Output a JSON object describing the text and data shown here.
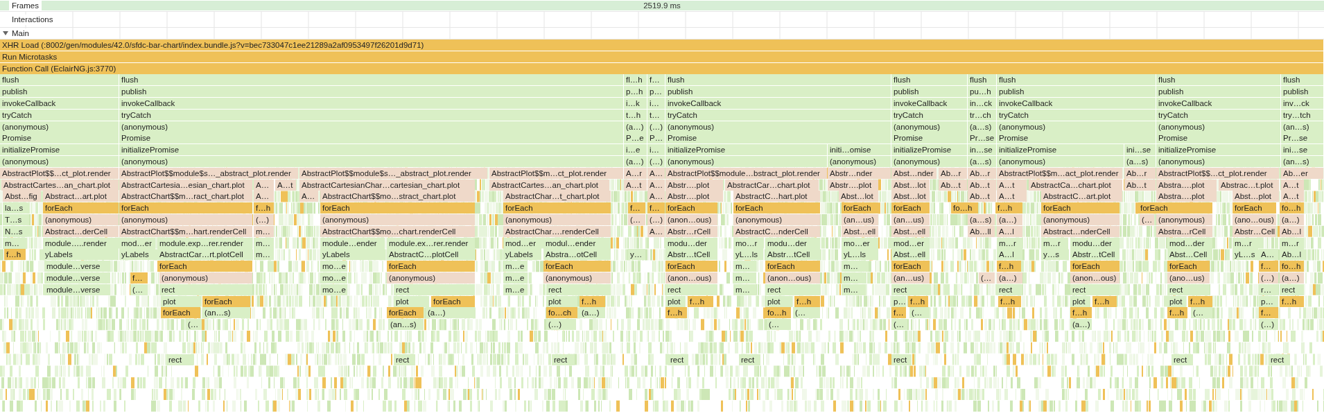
{
  "tracks": [
    {
      "label": "Frames",
      "duration": "2519.9 ms"
    },
    {
      "label": "Interactions"
    },
    {
      "label": "Main",
      "expanded": true
    }
  ],
  "flame_rows": [
    {
      "blocks": [
        {
          "label": "XHR Load (:8002/gen/modules/42.0/sfdc-bar-chart/index.bundle.js?v=bec733047c1ee21289a2af0953497f26201d9d71)",
          "color": "#efc158"
        }
      ]
    },
    {
      "blocks": [
        {
          "label": "Run Microtasks",
          "color": "#efc158"
        }
      ]
    },
    {
      "blocks": [
        {
          "label": "Function Call (EclairNG.js:3770)",
          "color": "#efc158"
        }
      ]
    },
    {
      "blocks": [
        {
          "label": "flush",
          "color": "#d9efc6"
        },
        {
          "label": "flush",
          "color": "#d9efc6"
        },
        {
          "label": "fl…h",
          "color": "#d9efc6"
        },
        {
          "label": "f…",
          "color": "#d9efc6"
        },
        {
          "label": "flush",
          "color": "#d9efc6"
        },
        {
          "label": "flush",
          "color": "#d9efc6"
        },
        {
          "label": "flush",
          "color": "#d9efc6"
        },
        {
          "label": "flush",
          "color": "#d9efc6"
        },
        {
          "label": "flush",
          "color": "#d9efc6"
        },
        {
          "label": "flush",
          "color": "#d9efc6"
        }
      ]
    },
    {
      "blocks": [
        {
          "label": "publish",
          "color": "#d9efc6"
        },
        {
          "label": "publish",
          "color": "#d9efc6"
        },
        {
          "label": "p…h",
          "color": "#d9efc6"
        },
        {
          "label": "p…",
          "color": "#d9efc6"
        },
        {
          "label": "publish",
          "color": "#d9efc6"
        },
        {
          "label": "publish",
          "color": "#d9efc6"
        },
        {
          "label": "pu…h",
          "color": "#d9efc6"
        },
        {
          "label": "publish",
          "color": "#d9efc6"
        },
        {
          "label": "publish",
          "color": "#d9efc6"
        },
        {
          "label": "publish",
          "color": "#d9efc6"
        }
      ]
    },
    {
      "blocks": [
        {
          "label": "invokeCallback",
          "color": "#d9efc6"
        },
        {
          "label": "invokeCallback",
          "color": "#d9efc6"
        },
        {
          "label": "i…k",
          "color": "#d9efc6"
        },
        {
          "label": "i…",
          "color": "#d9efc6"
        },
        {
          "label": "invokeCallback",
          "color": "#d9efc6"
        },
        {
          "label": "invokeCallback",
          "color": "#d9efc6"
        },
        {
          "label": "in…ck",
          "color": "#d9efc6"
        },
        {
          "label": "invokeCallback",
          "color": "#d9efc6"
        },
        {
          "label": "invokeCallback",
          "color": "#d9efc6"
        },
        {
          "label": "inv…ck",
          "color": "#d9efc6"
        }
      ]
    },
    {
      "blocks": [
        {
          "label": "tryCatch",
          "color": "#d9efc6"
        },
        {
          "label": "tryCatch",
          "color": "#d9efc6"
        },
        {
          "label": "t…h",
          "color": "#d9efc6"
        },
        {
          "label": "t…",
          "color": "#d9efc6"
        },
        {
          "label": "tryCatch",
          "color": "#d9efc6"
        },
        {
          "label": "tryCatch",
          "color": "#d9efc6"
        },
        {
          "label": "tr…ch",
          "color": "#d9efc6"
        },
        {
          "label": "tryCatch",
          "color": "#d9efc6"
        },
        {
          "label": "tryCatch",
          "color": "#d9efc6"
        },
        {
          "label": "try…tch",
          "color": "#d9efc6"
        }
      ]
    },
    {
      "blocks": [
        {
          "label": "(anonymous)",
          "color": "#d9efc6"
        },
        {
          "label": "(anonymous)",
          "color": "#d9efc6"
        },
        {
          "label": "(a…)",
          "color": "#d9efc6"
        },
        {
          "label": "(…)",
          "color": "#d9efc6"
        },
        {
          "label": "(anonymous)",
          "color": "#d9efc6"
        },
        {
          "label": "(anonymous)",
          "color": "#d9efc6"
        },
        {
          "label": "(a…s)",
          "color": "#d9efc6"
        },
        {
          "label": "(anonymous)",
          "color": "#d9efc6"
        },
        {
          "label": "(anonymous)",
          "color": "#d9efc6"
        },
        {
          "label": "(an…s)",
          "color": "#d9efc6"
        }
      ]
    },
    {
      "blocks": [
        {
          "label": "Promise",
          "color": "#d9efc6"
        },
        {
          "label": "Promise",
          "color": "#d9efc6"
        },
        {
          "label": "P…e",
          "color": "#d9efc6"
        },
        {
          "label": "P…",
          "color": "#d9efc6"
        },
        {
          "label": "Promise",
          "color": "#d9efc6"
        },
        {
          "label": "Promise",
          "color": "#d9efc6"
        },
        {
          "label": "Pr…se",
          "color": "#d9efc6"
        },
        {
          "label": "Promise",
          "color": "#d9efc6"
        },
        {
          "label": "Promise",
          "color": "#d9efc6"
        },
        {
          "label": "Pr…se",
          "color": "#d9efc6"
        }
      ]
    },
    {
      "blocks": [
        {
          "label": "initializePromise",
          "color": "#d9efc6"
        },
        {
          "label": "initializePromise",
          "color": "#d9efc6"
        },
        {
          "label": "i…e",
          "color": "#d9efc6"
        },
        {
          "label": "i…",
          "color": "#d9efc6"
        },
        {
          "label": "initializePromise",
          "color": "#d9efc6"
        },
        {
          "label": "initi…omise",
          "color": "#d9efc6"
        },
        {
          "label": "initializePromise",
          "color": "#d9efc6"
        },
        {
          "label": "in…se",
          "color": "#d9efc6"
        },
        {
          "label": "initializePromise",
          "color": "#d9efc6"
        },
        {
          "label": "ini…se",
          "color": "#d9efc6"
        },
        {
          "label": "initializePromise",
          "color": "#d9efc6"
        },
        {
          "label": "ini…se",
          "color": "#d9efc6"
        }
      ]
    },
    {
      "blocks": [
        {
          "label": "(anonymous)",
          "color": "#d9efc6"
        },
        {
          "label": "(anonymous)",
          "color": "#d9efc6"
        },
        {
          "label": "(a…)",
          "color": "#d9efc6"
        },
        {
          "label": "(…)",
          "color": "#d9efc6"
        },
        {
          "label": "(anonymous)",
          "color": "#d9efc6"
        },
        {
          "label": "(anonymous)",
          "color": "#d9efc6"
        },
        {
          "label": "(anonymous)",
          "color": "#d9efc6"
        },
        {
          "label": "(a…s)",
          "color": "#d9efc6"
        },
        {
          "label": "(anonymous)",
          "color": "#d9efc6"
        },
        {
          "label": "(a…s)",
          "color": "#d9efc6"
        },
        {
          "label": "(anonymous)",
          "color": "#d9efc6"
        },
        {
          "label": "(an…s)",
          "color": "#d9efc6"
        }
      ]
    },
    {
      "blocks": [
        {
          "label": "AbstractPlot$$…ct_plot.render",
          "color": "#efd9c9"
        },
        {
          "label": "AbstractPlot$$module$s…_abstract_plot.render",
          "color": "#efd9c9"
        },
        {
          "label": "AbstractPlot$$module$s…_abstract_plot.render",
          "color": "#efd9c9"
        },
        {
          "label": "AbstractPlot$$m…ct_plot.render",
          "color": "#efd9c9"
        },
        {
          "label": "A…r",
          "color": "#efd9c9"
        },
        {
          "label": "A…",
          "color": "#efd9c9"
        },
        {
          "label": "AbstractPlot$$module…bstract_plot.render",
          "color": "#efd9c9"
        },
        {
          "label": "Abstr…nder",
          "color": "#efd9c9"
        },
        {
          "label": "Abst…nder",
          "color": "#efd9c9"
        },
        {
          "label": "Ab…r",
          "color": "#efd9c9"
        },
        {
          "label": "Ab…r",
          "color": "#efd9c9"
        },
        {
          "label": "AbstractPlot$$m…act_plot.render",
          "color": "#efd9c9"
        },
        {
          "label": "Ab…r",
          "color": "#efd9c9"
        },
        {
          "label": "AbstractPlot$$…ct_plot.render",
          "color": "#efd9c9"
        },
        {
          "label": "Ab…er",
          "color": "#efd9c9"
        }
      ]
    },
    {
      "blocks": [
        {
          "label": "AbstractCartes…an_chart.plot",
          "color": "#efd9c9"
        },
        {
          "label": "AbstractCartesia…esian_chart.plot",
          "color": "#efd9c9"
        },
        {
          "label": "A…",
          "color": "#efd9c9"
        },
        {
          "label": "A…t",
          "color": "#efd9c9"
        },
        {
          "label": "AbstractCartesianChar…cartesian_chart.plot",
          "color": "#efd9c9"
        },
        {
          "label": "AbstractCartes…an_chart.plot",
          "color": "#efd9c9"
        },
        {
          "label": "A…t",
          "color": "#efd9c9"
        },
        {
          "label": "A…",
          "color": "#efd9c9"
        },
        {
          "label": "Abstr….plot",
          "color": "#efd9c9"
        },
        {
          "label": "AbstractCar…chart.plot",
          "color": "#efd9c9"
        },
        {
          "label": "Abstr….plot",
          "color": "#efd9c9"
        },
        {
          "label": "Abst…lot",
          "color": "#efd9c9"
        },
        {
          "label": "Ab…t",
          "color": "#efd9c9"
        },
        {
          "label": "Ab…t",
          "color": "#efd9c9"
        },
        {
          "label": "A…t",
          "color": "#efd9c9"
        },
        {
          "label": "AbstractCa…chart.plot",
          "color": "#efd9c9"
        },
        {
          "label": "Ab…t",
          "color": "#efd9c9"
        },
        {
          "label": "Abstra….plot",
          "color": "#efd9c9"
        },
        {
          "label": "Abstrac…t.plot",
          "color": "#efd9c9"
        },
        {
          "label": "A…t",
          "color": "#efd9c9"
        }
      ]
    },
    {
      "blocks": [
        {
          "label": "Abst…fig",
          "color": "#efd9c9"
        },
        {
          "label": "Abstract…art.plot",
          "color": "#efd9c9"
        },
        {
          "label": "AbstractChart$$m…ract_chart.plot",
          "color": "#efd9c9"
        },
        {
          "label": "A…",
          "color": "#efd9c9"
        },
        {
          "label": "A…",
          "color": "#efd9c9"
        },
        {
          "label": "AbstractChart$$mo…stract_chart.plot",
          "color": "#efd9c9"
        },
        {
          "label": "AbstractChar…t_chart.plot",
          "color": "#efd9c9"
        },
        {
          "label": "A…",
          "color": "#efd9c9"
        },
        {
          "label": "Abstr….plot",
          "color": "#efd9c9"
        },
        {
          "label": "AbstractC…hart.plot",
          "color": "#efd9c9"
        },
        {
          "label": "Abst…lot",
          "color": "#efd9c9"
        },
        {
          "label": "Abst…lot",
          "color": "#efd9c9"
        },
        {
          "label": "Ab…t",
          "color": "#efd9c9"
        },
        {
          "label": "A…t",
          "color": "#efd9c9"
        },
        {
          "label": "AbstractC…art.plot",
          "color": "#efd9c9"
        },
        {
          "label": "Abstra….plot",
          "color": "#efd9c9"
        },
        {
          "label": "Abst…plot",
          "color": "#efd9c9"
        },
        {
          "label": "A…t",
          "color": "#efd9c9"
        }
      ]
    },
    {
      "blocks": [
        {
          "label": "la…s",
          "color": "#d9efc6"
        },
        {
          "label": "forEach",
          "color": "#efc158"
        },
        {
          "label": "forEach",
          "color": "#efc158"
        },
        {
          "label": "f…h",
          "color": "#efc158"
        },
        {
          "label": "forEach",
          "color": "#efc158"
        },
        {
          "label": "forEach",
          "color": "#efc158"
        },
        {
          "label": "f…",
          "color": "#efc158"
        },
        {
          "label": "f…",
          "color": "#efc158"
        },
        {
          "label": "forEach",
          "color": "#efc158"
        },
        {
          "label": "forEach",
          "color": "#efc158"
        },
        {
          "label": "forEach",
          "color": "#efc158"
        },
        {
          "label": "forEach",
          "color": "#efc158"
        },
        {
          "label": "fo…h",
          "color": "#efc158"
        },
        {
          "label": "f…h",
          "color": "#efc158"
        },
        {
          "label": "forEach",
          "color": "#efc158"
        },
        {
          "label": "forEach",
          "color": "#efc158"
        },
        {
          "label": "forEach",
          "color": "#efc158"
        },
        {
          "label": "fo…h",
          "color": "#efc158"
        }
      ]
    },
    {
      "blocks": [
        {
          "label": "T…s",
          "color": "#d9efc6"
        },
        {
          "label": "(anonymous)",
          "color": "#efd9c9"
        },
        {
          "label": "(anonymous)",
          "color": "#efd9c9"
        },
        {
          "label": "(…)",
          "color": "#efd9c9"
        },
        {
          "label": "(anonymous)",
          "color": "#efd9c9"
        },
        {
          "label": "(anonymous)",
          "color": "#efd9c9"
        },
        {
          "label": "(…",
          "color": "#efd9c9"
        },
        {
          "label": "(…)",
          "color": "#efd9c9"
        },
        {
          "label": "(anon…ous)",
          "color": "#efd9c9"
        },
        {
          "label": "(anonymous)",
          "color": "#efd9c9"
        },
        {
          "label": "(an…us)",
          "color": "#efd9c9"
        },
        {
          "label": "(an…us)",
          "color": "#efd9c9"
        },
        {
          "label": "(a…s)",
          "color": "#efd9c9"
        },
        {
          "label": "(a…)",
          "color": "#efd9c9"
        },
        {
          "label": "(anonymous)",
          "color": "#efd9c9"
        },
        {
          "label": "(…",
          "color": "#efd9c9"
        },
        {
          "label": "(anonymous)",
          "color": "#efd9c9"
        },
        {
          "label": "(ano…ous)",
          "color": "#efd9c9"
        },
        {
          "label": "(a…)",
          "color": "#efd9c9"
        }
      ]
    },
    {
      "blocks": [
        {
          "label": "N…s",
          "color": "#d9efc6"
        },
        {
          "label": "Abstract…derCell",
          "color": "#efd9c9"
        },
        {
          "label": "AbstractChart$$m…hart.renderCell",
          "color": "#efd9c9"
        },
        {
          "label": "m…",
          "color": "#efd9c9"
        },
        {
          "label": "AbstractChart$$mo…chart.renderCell",
          "color": "#efd9c9"
        },
        {
          "label": "AbstractChar….renderCell",
          "color": "#efd9c9"
        },
        {
          "label": "A…",
          "color": "#efd9c9"
        },
        {
          "label": "Abstr…rCell",
          "color": "#efd9c9"
        },
        {
          "label": "AbstractC…nderCell",
          "color": "#efd9c9"
        },
        {
          "label": "Abst…ell",
          "color": "#efd9c9"
        },
        {
          "label": "Abst…ell",
          "color": "#efd9c9"
        },
        {
          "label": "Ab…ll",
          "color": "#efd9c9"
        },
        {
          "label": "A…l",
          "color": "#efd9c9"
        },
        {
          "label": "Abstract…nderCell",
          "color": "#efd9c9"
        },
        {
          "label": "Abstra…rCell",
          "color": "#efd9c9"
        },
        {
          "label": "Abstr…Cell",
          "color": "#efd9c9"
        },
        {
          "label": "Ab…l",
          "color": "#efd9c9"
        }
      ]
    },
    {
      "blocks": [
        {
          "label": "m…",
          "color": "#d9efc6"
        },
        {
          "label": "module…..render",
          "color": "#d9efc6"
        },
        {
          "label": "mod…er",
          "color": "#d9efc6"
        },
        {
          "label": "module.exp…rer.render",
          "color": "#d9efc6"
        },
        {
          "label": "m…",
          "color": "#d9efc6"
        },
        {
          "label": "module…ender",
          "color": "#d9efc6"
        },
        {
          "label": "module.ex…rer.render",
          "color": "#d9efc6"
        },
        {
          "label": "mod…er",
          "color": "#d9efc6"
        },
        {
          "label": "modul…ender",
          "color": "#d9efc6"
        },
        {
          "label": "modu…der",
          "color": "#d9efc6"
        },
        {
          "label": "mo…r",
          "color": "#d9efc6"
        },
        {
          "label": "modu…der",
          "color": "#d9efc6"
        },
        {
          "label": "mo…er",
          "color": "#d9efc6"
        },
        {
          "label": "mod…er",
          "color": "#d9efc6"
        },
        {
          "label": "m…r",
          "color": "#d9efc6"
        },
        {
          "label": "m…r",
          "color": "#d9efc6"
        },
        {
          "label": "modu…der",
          "color": "#d9efc6"
        },
        {
          "label": "mod…der",
          "color": "#d9efc6"
        },
        {
          "label": "m…r",
          "color": "#d9efc6"
        },
        {
          "label": "m…r",
          "color": "#d9efc6"
        }
      ]
    },
    {
      "blocks": [
        {
          "label": "f…h",
          "color": "#efc158"
        },
        {
          "label": "yLabels",
          "color": "#d9efc6"
        },
        {
          "label": "yLabels",
          "color": "#d9efc6"
        },
        {
          "label": "AbstractCar…rt.plotCell",
          "color": "#d9efc6"
        },
        {
          "label": "m…",
          "color": "#d9efc6"
        },
        {
          "label": "yLabels",
          "color": "#d9efc6"
        },
        {
          "label": "AbstractC…plotCell",
          "color": "#d9efc6"
        },
        {
          "label": "yLabels",
          "color": "#d9efc6"
        },
        {
          "label": "Abstra…otCell",
          "color": "#d9efc6"
        },
        {
          "label": "y…",
          "color": "#d9efc6"
        },
        {
          "label": "Abstr…tCell",
          "color": "#d9efc6"
        },
        {
          "label": "yL…ls",
          "color": "#d9efc6"
        },
        {
          "label": "Abstr…tCell",
          "color": "#d9efc6"
        },
        {
          "label": "yL…ls",
          "color": "#d9efc6"
        },
        {
          "label": "Abst…ell",
          "color": "#d9efc6"
        },
        {
          "label": "A…l",
          "color": "#d9efc6"
        },
        {
          "label": "y…s",
          "color": "#d9efc6"
        },
        {
          "label": "Abstr…tCell",
          "color": "#d9efc6"
        },
        {
          "label": "Abst…Cell",
          "color": "#d9efc6"
        },
        {
          "label": "yL…s",
          "color": "#d9efc6"
        },
        {
          "label": "A…",
          "color": "#d9efc6"
        },
        {
          "label": "Ab…l",
          "color": "#d9efc6"
        }
      ]
    },
    {
      "blocks": [
        {
          "label": "module…verse",
          "color": "#d9efc6"
        },
        {
          "label": "forEach",
          "color": "#efc158"
        },
        {
          "label": "mo…e",
          "color": "#d9efc6"
        },
        {
          "label": "forEach",
          "color": "#efc158"
        },
        {
          "label": "m…e",
          "color": "#d9efc6"
        },
        {
          "label": "forEach",
          "color": "#efc158"
        },
        {
          "label": "forEach",
          "color": "#efc158"
        },
        {
          "label": "m…",
          "color": "#d9efc6"
        },
        {
          "label": "forEach",
          "color": "#efc158"
        },
        {
          "label": "m…",
          "color": "#d9efc6"
        },
        {
          "label": "forEach",
          "color": "#efc158"
        },
        {
          "label": "f…h",
          "color": "#efc158"
        },
        {
          "label": "forEach",
          "color": "#efc158"
        },
        {
          "label": "forEach",
          "color": "#efc158"
        },
        {
          "label": "f…",
          "color": "#efc158"
        },
        {
          "label": "fo…h",
          "color": "#efc158"
        }
      ]
    },
    {
      "blocks": [
        {
          "label": "module…verse",
          "color": "#d9efc6"
        },
        {
          "label": "f…",
          "color": "#efc158"
        },
        {
          "label": "(anonymous)",
          "color": "#efd9c9"
        },
        {
          "label": "mo…e",
          "color": "#d9efc6"
        },
        {
          "label": "(anonymous)",
          "color": "#efd9c9"
        },
        {
          "label": "m…e",
          "color": "#d9efc6"
        },
        {
          "label": "(anonymous)",
          "color": "#efd9c9"
        },
        {
          "label": "(anon…ous)",
          "color": "#efd9c9"
        },
        {
          "label": "m…",
          "color": "#d9efc6"
        },
        {
          "label": "(anon…ous)",
          "color": "#efd9c9"
        },
        {
          "label": "m…",
          "color": "#d9efc6"
        },
        {
          "label": "(an…us)",
          "color": "#efd9c9"
        },
        {
          "label": "(…",
          "color": "#efd9c9"
        },
        {
          "label": "(a…)",
          "color": "#efd9c9"
        },
        {
          "label": "(anon…ous)",
          "color": "#efd9c9"
        },
        {
          "label": "(ano…us)",
          "color": "#efd9c9"
        },
        {
          "label": "(…)",
          "color": "#efd9c9"
        },
        {
          "label": "(a…)",
          "color": "#efd9c9"
        }
      ]
    },
    {
      "blocks": [
        {
          "label": "module…verse",
          "color": "#d9efc6"
        },
        {
          "label": "(…",
          "color": "#d9efc6"
        },
        {
          "label": "rect",
          "color": "#d9efc6"
        },
        {
          "label": "mo…e",
          "color": "#d9efc6"
        },
        {
          "label": "rect",
          "color": "#d9efc6"
        },
        {
          "label": "m…e",
          "color": "#d9efc6"
        },
        {
          "label": "rect",
          "color": "#d9efc6"
        },
        {
          "label": "rect",
          "color": "#d9efc6"
        },
        {
          "label": "m…",
          "color": "#d9efc6"
        },
        {
          "label": "rect",
          "color": "#d9efc6"
        },
        {
          "label": "m…",
          "color": "#d9efc6"
        },
        {
          "label": "rect",
          "color": "#d9efc6"
        },
        {
          "label": "rect",
          "color": "#d9efc6"
        },
        {
          "label": "rect",
          "color": "#d9efc6"
        },
        {
          "label": "rect",
          "color": "#d9efc6"
        },
        {
          "label": "r…",
          "color": "#d9efc6"
        },
        {
          "label": "rect",
          "color": "#d9efc6"
        }
      ]
    },
    {
      "blocks": [
        {
          "label": "plot",
          "color": "#d9efc6"
        },
        {
          "label": "forEach",
          "color": "#efc158"
        },
        {
          "label": "plot",
          "color": "#d9efc6"
        },
        {
          "label": "forEach",
          "color": "#efc158"
        },
        {
          "label": "plot",
          "color": "#d9efc6"
        },
        {
          "label": "f…h",
          "color": "#efc158"
        },
        {
          "label": "plot",
          "color": "#d9efc6"
        },
        {
          "label": "f…h",
          "color": "#efc158"
        },
        {
          "label": "plot",
          "color": "#d9efc6"
        },
        {
          "label": "f…h",
          "color": "#efc158"
        },
        {
          "label": "p…",
          "color": "#d9efc6"
        },
        {
          "label": "f…h",
          "color": "#efc158"
        },
        {
          "label": "f…h",
          "color": "#efc158"
        },
        {
          "label": "plot",
          "color": "#d9efc6"
        },
        {
          "label": "f…h",
          "color": "#efc158"
        },
        {
          "label": "plot",
          "color": "#d9efc6"
        },
        {
          "label": "f…h",
          "color": "#efc158"
        },
        {
          "label": "p…",
          "color": "#d9efc6"
        },
        {
          "label": "f…h",
          "color": "#efc158"
        }
      ]
    },
    {
      "blocks": [
        {
          "label": "forEach",
          "color": "#efc158"
        },
        {
          "label": "(an…s)",
          "color": "#d9efc6"
        },
        {
          "label": "forEach",
          "color": "#efc158"
        },
        {
          "label": "(a…)",
          "color": "#d9efc6"
        },
        {
          "label": "fo…ch",
          "color": "#efc158"
        },
        {
          "label": "(a…)",
          "color": "#d9efc6"
        },
        {
          "label": "f…h",
          "color": "#efc158"
        },
        {
          "label": "fo…h",
          "color": "#efc158"
        },
        {
          "label": "(…",
          "color": "#d9efc6"
        },
        {
          "label": "f…",
          "color": "#efc158"
        },
        {
          "label": "(…",
          "color": "#d9efc6"
        },
        {
          "label": "f…h",
          "color": "#efc158"
        },
        {
          "label": "f…h",
          "color": "#efc158"
        },
        {
          "label": "(…",
          "color": "#d9efc6"
        },
        {
          "label": "f…",
          "color": "#efc158"
        }
      ]
    },
    {
      "blocks": [
        {
          "label": "(…",
          "color": "#d9efc6"
        },
        {
          "label": "(an…s)",
          "color": "#d9efc6"
        },
        {
          "label": "(…)",
          "color": "#d9efc6"
        },
        {
          "label": "(…",
          "color": "#d9efc6"
        },
        {
          "label": "(…",
          "color": "#d9efc6"
        },
        {
          "label": "(a…)",
          "color": "#d9efc6"
        },
        {
          "label": "(…)",
          "color": "#d9efc6"
        }
      ]
    },
    {
      "blocks": [
        {
          "label": "rect",
          "color": "#d9efc6"
        },
        {
          "label": "rect",
          "color": "#d9efc6"
        },
        {
          "label": "rect",
          "color": "#d9efc6"
        },
        {
          "label": "rect",
          "color": "#d9efc6"
        },
        {
          "label": "rect",
          "color": "#d9efc6"
        },
        {
          "label": "rect",
          "color": "#d9efc6"
        },
        {
          "label": "rect",
          "color": "#d9efc6"
        },
        {
          "label": "rect",
          "color": "#d9efc6"
        }
      ]
    }
  ]
}
